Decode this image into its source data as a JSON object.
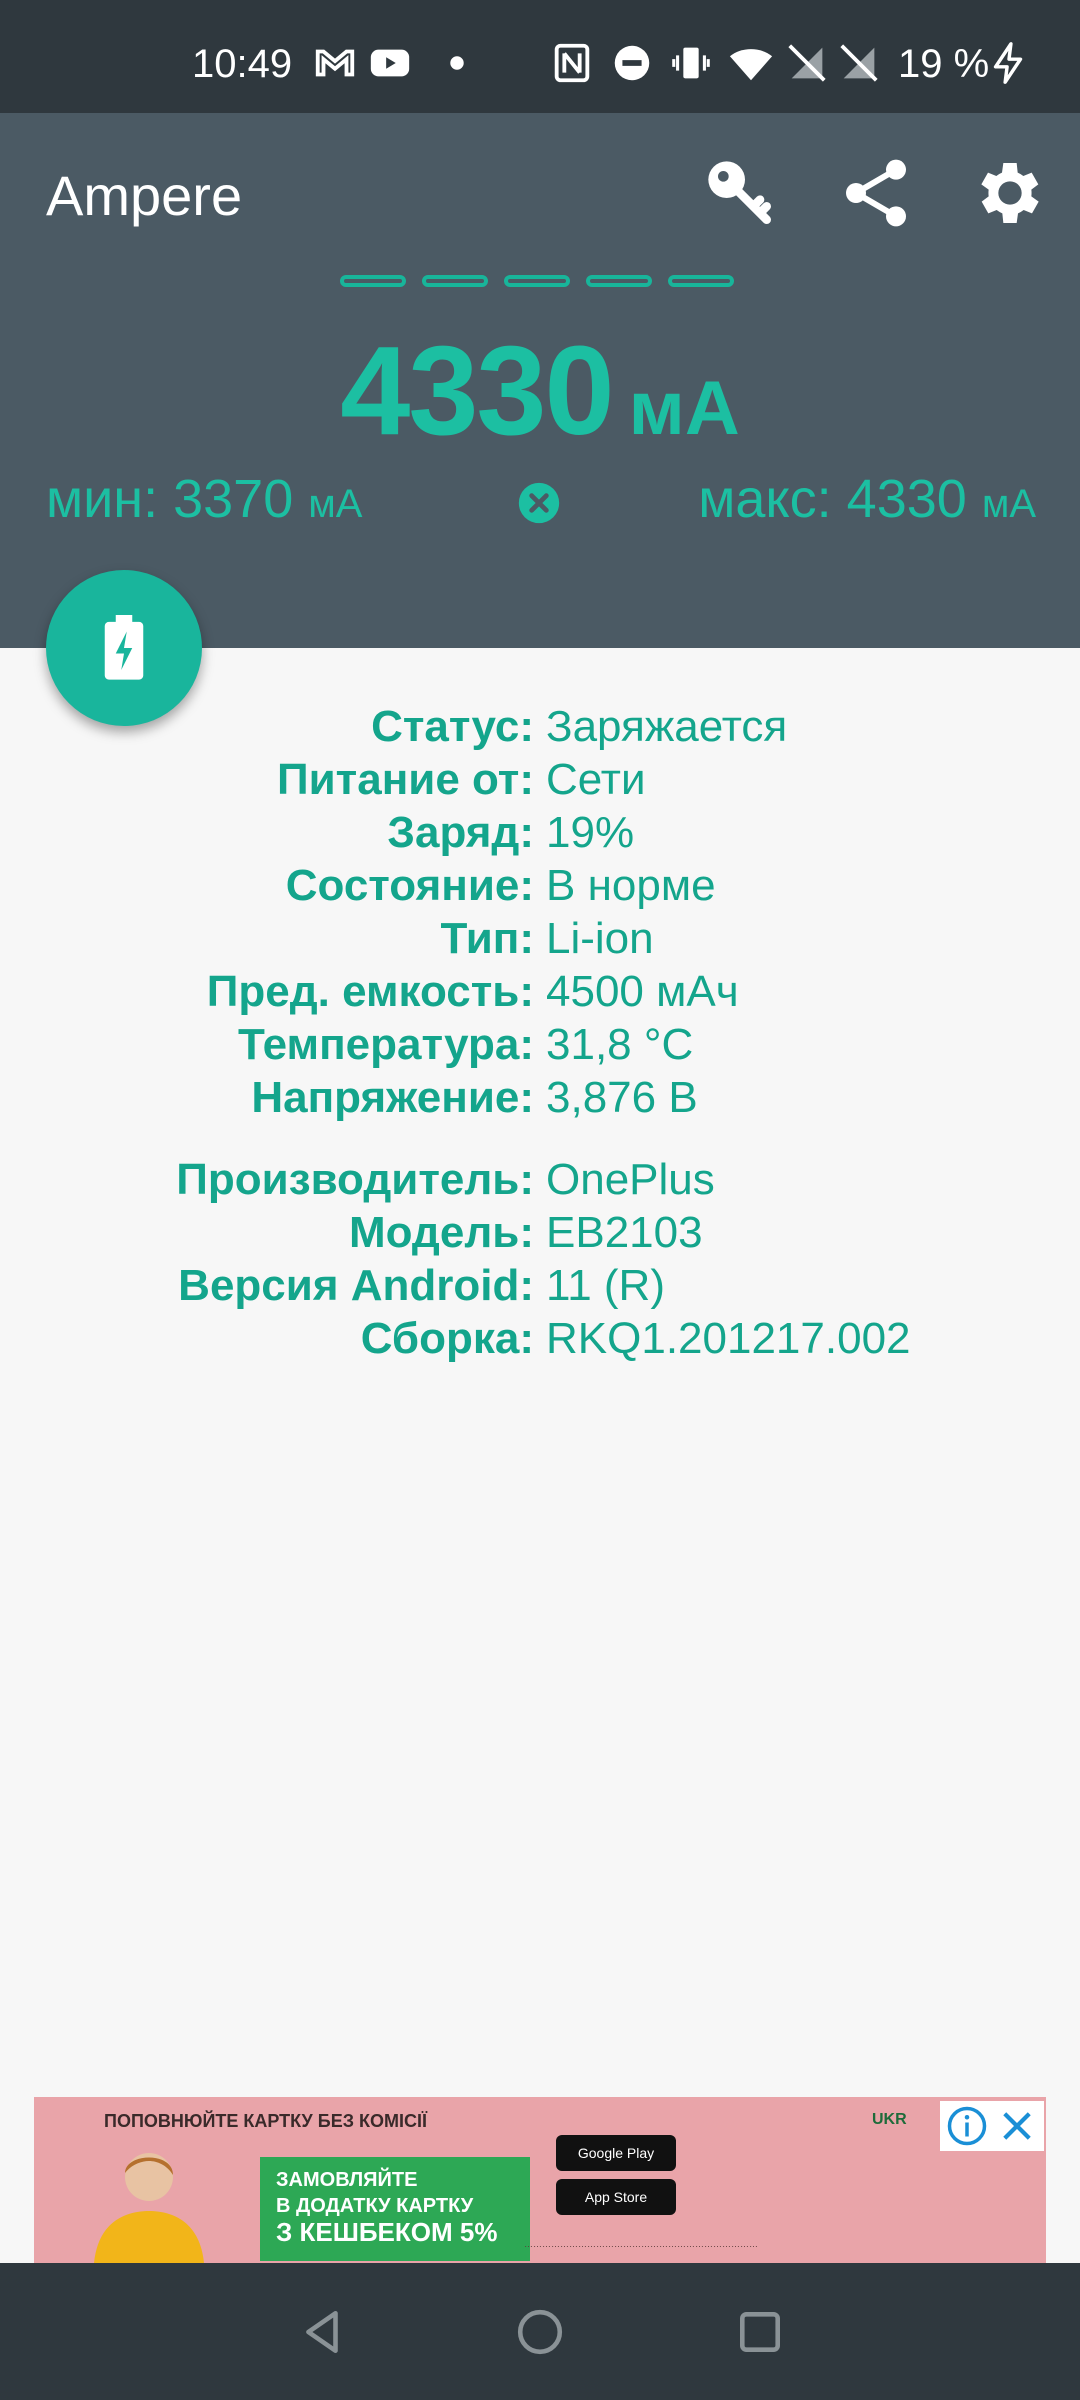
{
  "status_bar": {
    "time": "10:49",
    "battery_percent": "19 %",
    "icons": [
      "gmail-icon",
      "youtube-icon",
      "dot-icon",
      "nfc-icon",
      "dnd-icon",
      "vibrate-icon",
      "wifi-icon",
      "no-sim-icon",
      "no-sim-icon",
      "charging-bolt-icon"
    ]
  },
  "app_bar": {
    "title": "Ampere",
    "actions": [
      "key-icon",
      "share-icon",
      "settings-icon"
    ]
  },
  "measurement": {
    "current": "4330",
    "unit": "мА",
    "min_label": "мин: 3370",
    "min_unit": "мА",
    "max_label": "макс: 4330",
    "max_unit": "мА",
    "indicator_segments": 5
  },
  "battery_info": [
    {
      "label": "Статус:",
      "value": "Заряжается"
    },
    {
      "label": "Питание от:",
      "value": "Сети"
    },
    {
      "label": "Заряд:",
      "value": "19%"
    },
    {
      "label": "Состояние:",
      "value": "В норме"
    },
    {
      "label": "Тип:",
      "value": "Li-ion"
    },
    {
      "label": "Пред. емкость:",
      "value": "4500 мАч"
    },
    {
      "label": "Температура:",
      "value": "31,8 °C"
    },
    {
      "label": "Напряжение:",
      "value": "3,876 В"
    }
  ],
  "device_info": [
    {
      "label": "Производитель:",
      "value": "OnePlus"
    },
    {
      "label": "Модель:",
      "value": "EB2103"
    },
    {
      "label": "Версия Android:",
      "value": "11 (R)"
    },
    {
      "label": "Сборка:",
      "value": "RKQ1.201217.002"
    }
  ],
  "ad": {
    "top_text": "ПОПОВНЮЙТЕ КАРТКУ БЕЗ КОМІСІЇ",
    "green_line1": "ЗАМОВЛЯЙТЕ",
    "green_line2": "В ДОДАТКУ КАРТКУ",
    "green_line3": "З КЕШБЕКОМ 5%",
    "store1": "Google Play",
    "store2": "App Store",
    "brand": "UKR"
  },
  "colors": {
    "accent": "#1cbfa2",
    "header_bg": "#4b5a64",
    "status_bar_bg": "#2f383e",
    "body_bg": "#f7f7f7"
  }
}
